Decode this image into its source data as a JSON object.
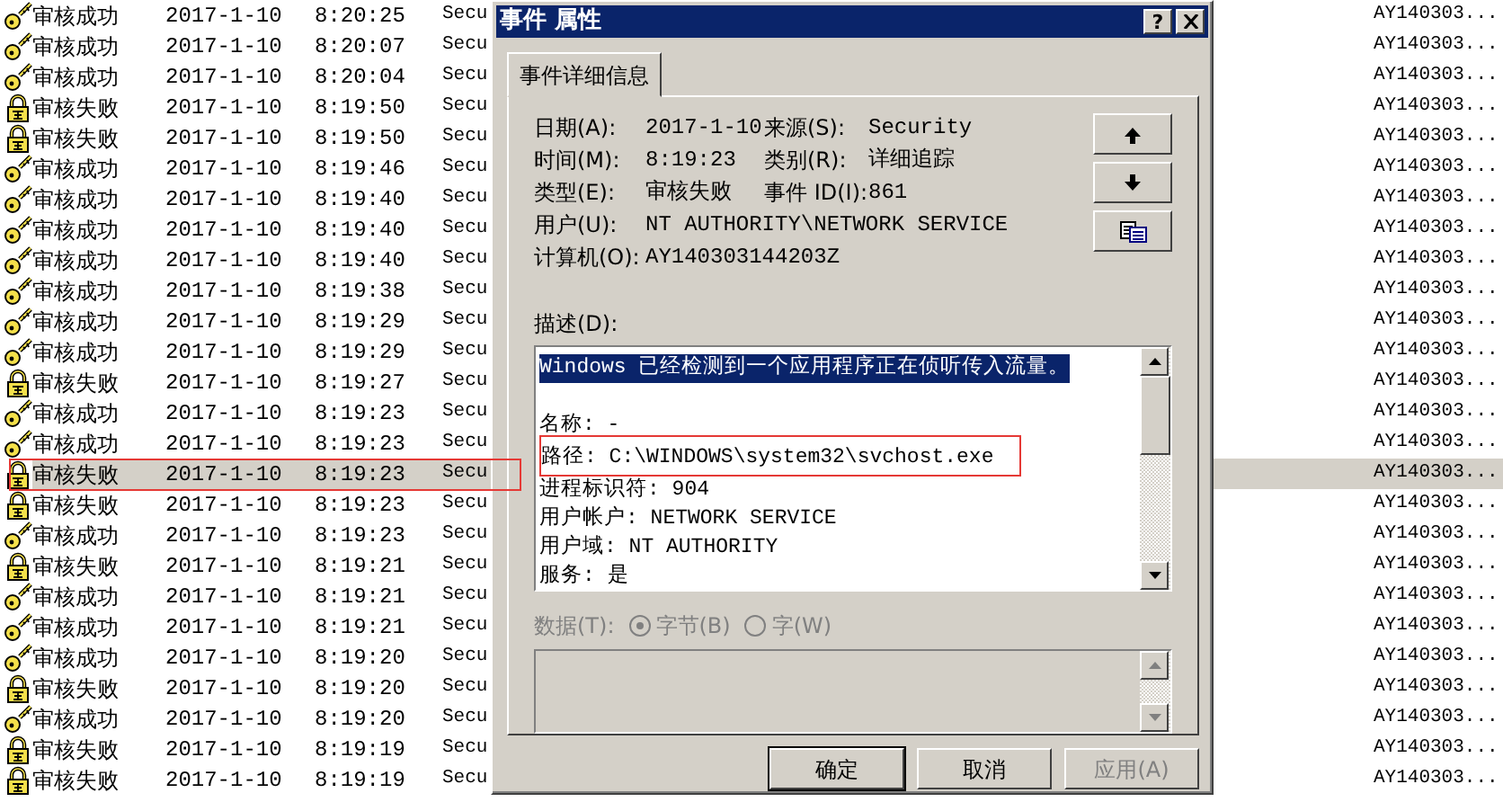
{
  "event_list": {
    "rows": [
      {
        "kind": "success",
        "type": "审核成功",
        "date": "2017-1-10",
        "time": "8:20:25",
        "source": "Secu",
        "computer": "AY140303...",
        "selected": false
      },
      {
        "kind": "success",
        "type": "审核成功",
        "date": "2017-1-10",
        "time": "8:20:07",
        "source": "Secu",
        "computer": "AY140303...",
        "selected": false
      },
      {
        "kind": "success",
        "type": "审核成功",
        "date": "2017-1-10",
        "time": "8:20:04",
        "source": "Secu",
        "computer": "AY140303...",
        "selected": false
      },
      {
        "kind": "failure",
        "type": "审核失败",
        "date": "2017-1-10",
        "time": "8:19:50",
        "source": "Secu",
        "computer": "AY140303...",
        "selected": false
      },
      {
        "kind": "failure",
        "type": "审核失败",
        "date": "2017-1-10",
        "time": "8:19:50",
        "source": "Secu",
        "computer": "AY140303...",
        "selected": false
      },
      {
        "kind": "success",
        "type": "审核成功",
        "date": "2017-1-10",
        "time": "8:19:46",
        "source": "Secu",
        "computer": "AY140303...",
        "selected": false
      },
      {
        "kind": "success",
        "type": "审核成功",
        "date": "2017-1-10",
        "time": "8:19:40",
        "source": "Secu",
        "computer": "AY140303...",
        "selected": false
      },
      {
        "kind": "success",
        "type": "审核成功",
        "date": "2017-1-10",
        "time": "8:19:40",
        "source": "Secu",
        "computer": "AY140303...",
        "selected": false
      },
      {
        "kind": "success",
        "type": "审核成功",
        "date": "2017-1-10",
        "time": "8:19:40",
        "source": "Secu",
        "computer": "AY140303...",
        "selected": false
      },
      {
        "kind": "success",
        "type": "审核成功",
        "date": "2017-1-10",
        "time": "8:19:38",
        "source": "Secu",
        "computer": "AY140303...",
        "selected": false
      },
      {
        "kind": "success",
        "type": "审核成功",
        "date": "2017-1-10",
        "time": "8:19:29",
        "source": "Secu",
        "computer": "AY140303...",
        "selected": false
      },
      {
        "kind": "success",
        "type": "审核成功",
        "date": "2017-1-10",
        "time": "8:19:29",
        "source": "Secu",
        "computer": "AY140303...",
        "selected": false
      },
      {
        "kind": "failure",
        "type": "审核失败",
        "date": "2017-1-10",
        "time": "8:19:27",
        "source": "Secu",
        "computer": "AY140303...",
        "selected": false
      },
      {
        "kind": "success",
        "type": "审核成功",
        "date": "2017-1-10",
        "time": "8:19:23",
        "source": "Secu",
        "computer": "AY140303...",
        "selected": false
      },
      {
        "kind": "success",
        "type": "审核成功",
        "date": "2017-1-10",
        "time": "8:19:23",
        "source": "Secu",
        "computer": "AY140303...",
        "selected": false
      },
      {
        "kind": "failure",
        "type": "审核失败",
        "date": "2017-1-10",
        "time": "8:19:23",
        "source": "Secu",
        "computer": "AY140303...",
        "selected": true
      },
      {
        "kind": "failure",
        "type": "审核失败",
        "date": "2017-1-10",
        "time": "8:19:23",
        "source": "Secu",
        "computer": "AY140303...",
        "selected": false
      },
      {
        "kind": "success",
        "type": "审核成功",
        "date": "2017-1-10",
        "time": "8:19:23",
        "source": "Secu",
        "computer": "AY140303...",
        "selected": false
      },
      {
        "kind": "failure",
        "type": "审核失败",
        "date": "2017-1-10",
        "time": "8:19:21",
        "source": "Secu",
        "computer": "AY140303...",
        "selected": false
      },
      {
        "kind": "success",
        "type": "审核成功",
        "date": "2017-1-10",
        "time": "8:19:21",
        "source": "Secu",
        "computer": "AY140303...",
        "selected": false
      },
      {
        "kind": "success",
        "type": "审核成功",
        "date": "2017-1-10",
        "time": "8:19:21",
        "source": "Secu",
        "computer": "AY140303...",
        "selected": false
      },
      {
        "kind": "success",
        "type": "审核成功",
        "date": "2017-1-10",
        "time": "8:19:20",
        "source": "Secu",
        "computer": "AY140303...",
        "selected": false
      },
      {
        "kind": "failure",
        "type": "审核失败",
        "date": "2017-1-10",
        "time": "8:19:20",
        "source": "Secu",
        "computer": "AY140303...",
        "selected": false
      },
      {
        "kind": "success",
        "type": "审核成功",
        "date": "2017-1-10",
        "time": "8:19:20",
        "source": "Secu",
        "computer": "AY140303...",
        "selected": false
      },
      {
        "kind": "failure",
        "type": "审核失败",
        "date": "2017-1-10",
        "time": "8:19:19",
        "source": "Secu",
        "computer": "AY140303...",
        "selected": false
      },
      {
        "kind": "failure",
        "type": "审核失败",
        "date": "2017-1-10",
        "time": "8:19:19",
        "source": "Secu",
        "computer": "AY140303...",
        "selected": false
      }
    ]
  },
  "dialog": {
    "title": "事件 属性",
    "help_button": "?",
    "tabs": [
      {
        "label": "事件详细信息",
        "selected": true
      }
    ],
    "properties": [
      [
        {
          "label": "日期(A):",
          "value": "2017-1-10"
        },
        {
          "label": "来源(S):",
          "value": "Security"
        }
      ],
      [
        {
          "label": "时间(M):",
          "value": "8:19:23"
        },
        {
          "label": "类别(R):",
          "value": "详细追踪"
        }
      ],
      [
        {
          "label": "类型(E):",
          "value": "审核失败"
        },
        {
          "label": "事件 ID(I):",
          "value": "861"
        }
      ],
      [
        {
          "label": "用户(U):",
          "value": "NT AUTHORITY\\NETWORK SERVICE"
        }
      ],
      [
        {
          "label": "计算机(O):",
          "value": "AY140303144203Z"
        }
      ]
    ],
    "description": {
      "label": "描述(D):",
      "paragraphs": [
        {
          "lines": [
            {
              "text": "Windows 已经检测到一个应用程序正在侦听传入流量。",
              "selected": true
            }
          ]
        },
        {
          "lines": [
            {
              "text": "名称: -",
              "selected": false
            },
            {
              "text": "路径: C:\\WINDOWS\\system32\\svchost.exe",
              "selected": false,
              "annotated": true
            },
            {
              "text": "进程标识符: 904",
              "selected": false
            },
            {
              "text": "用户帐户: NETWORK SERVICE",
              "selected": false
            },
            {
              "text": "用户域: NT AUTHORITY",
              "selected": false
            },
            {
              "text": "服务: 是",
              "selected": false
            }
          ]
        }
      ]
    },
    "data": {
      "label": "数据(T):",
      "disabled": true,
      "options": [
        {
          "label": "字节(B)",
          "checked": true
        },
        {
          "label": "字(W)",
          "checked": false
        }
      ]
    },
    "buttons": [
      {
        "label": "确定",
        "default": true,
        "disabled": false
      },
      {
        "label": "取消",
        "default": false,
        "disabled": false
      },
      {
        "label": "应用(A)",
        "default": false,
        "disabled": true
      }
    ]
  }
}
